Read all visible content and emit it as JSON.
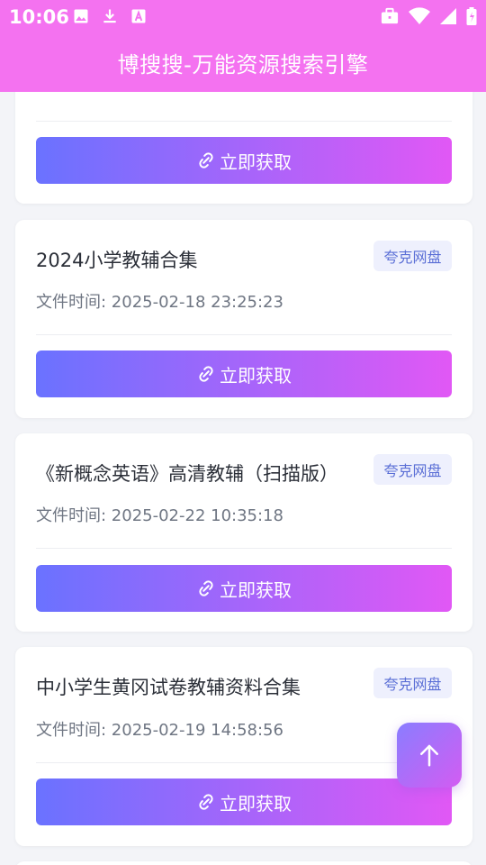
{
  "status_bar": {
    "time": "10:06"
  },
  "app_bar": {
    "title": "博搜搜-万能资源搜索引擎"
  },
  "results": [
    {
      "title": "",
      "file_time": "",
      "button_label": "立即获取"
    },
    {
      "title": "2024小学教辅合集",
      "tag": "夸克网盘",
      "file_time": "文件时间: 2025-02-18 23:25:23",
      "button_label": "立即获取"
    },
    {
      "title": "《新概念英语》高清教辅（扫描版）",
      "tag": "夸克网盘",
      "file_time": "文件时间: 2025-02-22 10:35:18",
      "button_label": "立即获取"
    },
    {
      "title": "中小学生黄冈试卷教辅资料合集",
      "tag": "夸克网盘",
      "file_time": "文件时间: 2025-02-19 14:58:56",
      "button_label": "立即获取"
    }
  ],
  "colors": {
    "app_bar": "#f472f0",
    "button_gradient_start": "#6a72ff",
    "button_gradient_end": "#e158f5",
    "tag_text": "#5b6fd6",
    "tag_bg": "#eef0fd"
  },
  "icons": {
    "status_left": [
      "image-icon",
      "download-icon",
      "text-icon"
    ],
    "status_right": [
      "briefcase-icon",
      "wifi-icon",
      "signal-icon",
      "battery-icon"
    ],
    "button": "link-icon",
    "fab": "arrow-up-icon"
  }
}
